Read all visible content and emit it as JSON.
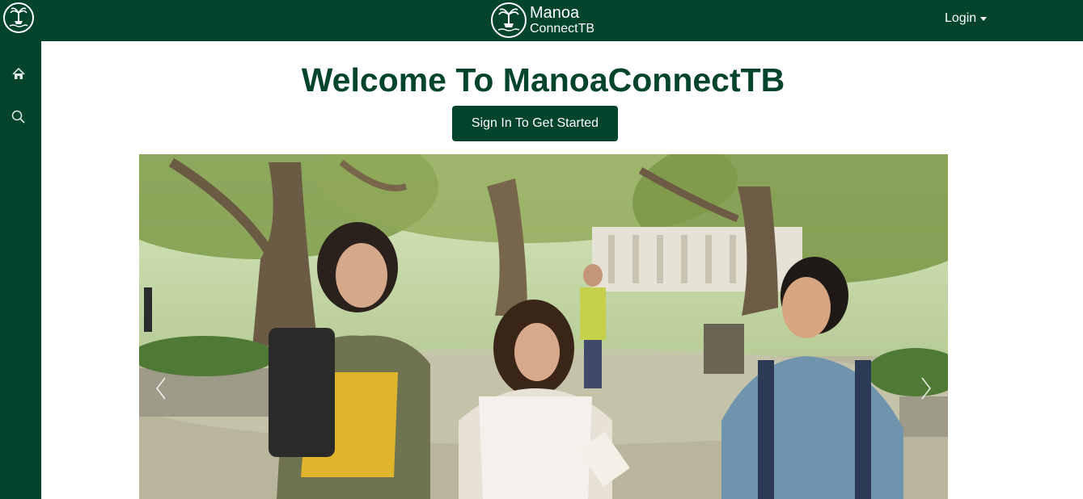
{
  "header": {
    "brand_line1": "Manoa",
    "brand_line2": "ConnectTB",
    "login_label": "Login"
  },
  "sidebar": {
    "items": [
      {
        "icon": "home-icon"
      },
      {
        "icon": "search-icon"
      }
    ]
  },
  "main": {
    "title": "Welcome To ManoaConnectTB",
    "signin_button": "Sign In To Get Started"
  },
  "carousel": {
    "image_alt": "",
    "prev_icon": "chevron-left-icon",
    "next_icon": "chevron-right-icon"
  },
  "colors": {
    "brand_green": "#004430",
    "white": "#ffffff"
  }
}
